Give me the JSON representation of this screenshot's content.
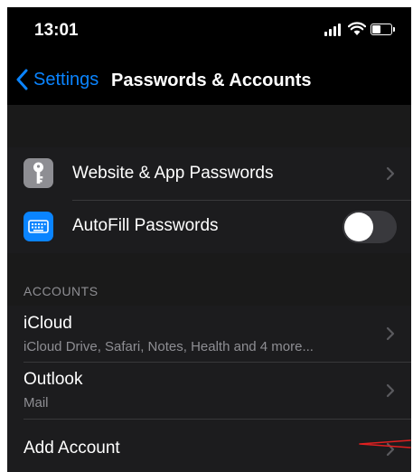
{
  "status_bar": {
    "time": "13:01",
    "signal_icon": "cellular-signal-icon",
    "wifi_icon": "wifi-icon",
    "battery_icon": "battery-icon"
  },
  "nav": {
    "back_label": "Settings",
    "title": "Passwords & Accounts"
  },
  "passwords_group": {
    "items": [
      {
        "label": "Website & App Passwords",
        "icon": "key-icon",
        "icon_color": "#8e8e93",
        "accessory": "chevron"
      },
      {
        "label": "AutoFill Passwords",
        "icon": "keyboard-icon",
        "icon_color": "#0a84ff",
        "accessory": "toggle",
        "toggle_on": false
      }
    ]
  },
  "accounts_section": {
    "header": "ACCOUNTS",
    "items": [
      {
        "title": "iCloud",
        "subtitle": "iCloud Drive, Safari, Notes, Health and 4 more..."
      },
      {
        "title": "Outlook",
        "subtitle": "Mail"
      },
      {
        "title": "Add Account"
      }
    ]
  },
  "colors": {
    "background": "#000000",
    "group_background": "#1c1c1e",
    "accent": "#0a84ff",
    "secondary_text": "#8e8e93",
    "annotation": "#e02020"
  }
}
